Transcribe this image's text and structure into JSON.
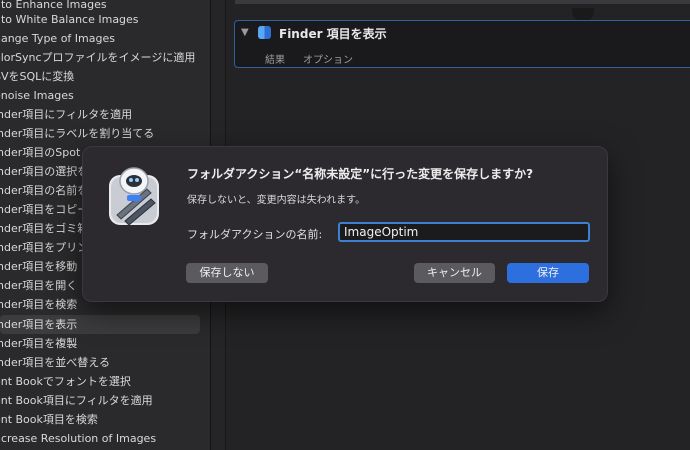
{
  "sidebar": {
    "items": [
      "uto Enhance Images",
      "uto White Balance Images",
      "hange Type of Images",
      "olorSyncプロファイルをイメージに適用",
      "SVをSQLに変換",
      "enoise Images",
      "inder項目にフィルタを適用",
      "inder項目にラベルを割り当てる",
      "inder項目のSpot",
      "inder項目の選択を",
      "inder項目の名前を",
      "inder項目をコピー",
      "inder項目をゴミ箱",
      "inder項目をプリン",
      "inder項目を移動",
      "inder項目を開く",
      "inder項目を検索",
      "inder項目を表示",
      "inder項目を複製",
      "inder項目を並べ替える",
      "ont Bookでフォントを選択",
      "ont Book項目にフィルタを適用",
      "ont Book項目を検索",
      "ncrease Resolution of Images"
    ]
  },
  "action_card": {
    "title": "Finder 項目を表示",
    "tab_results": "結果",
    "tab_options": "オプション"
  },
  "dialog": {
    "title": "フォルダアクション“名称未設定”に行った変更を保存しますか?",
    "message": "保存しないと、変更内容は失われます。",
    "name_label": "フォルダアクションの名前:",
    "name_value": "ImageOptim",
    "dont_save_label": "保存しない",
    "cancel_label": "キャンセル",
    "save_label": "保存"
  },
  "colors": {
    "accent": "#2e6fe0",
    "focus_ring": "#3d7fd3"
  }
}
